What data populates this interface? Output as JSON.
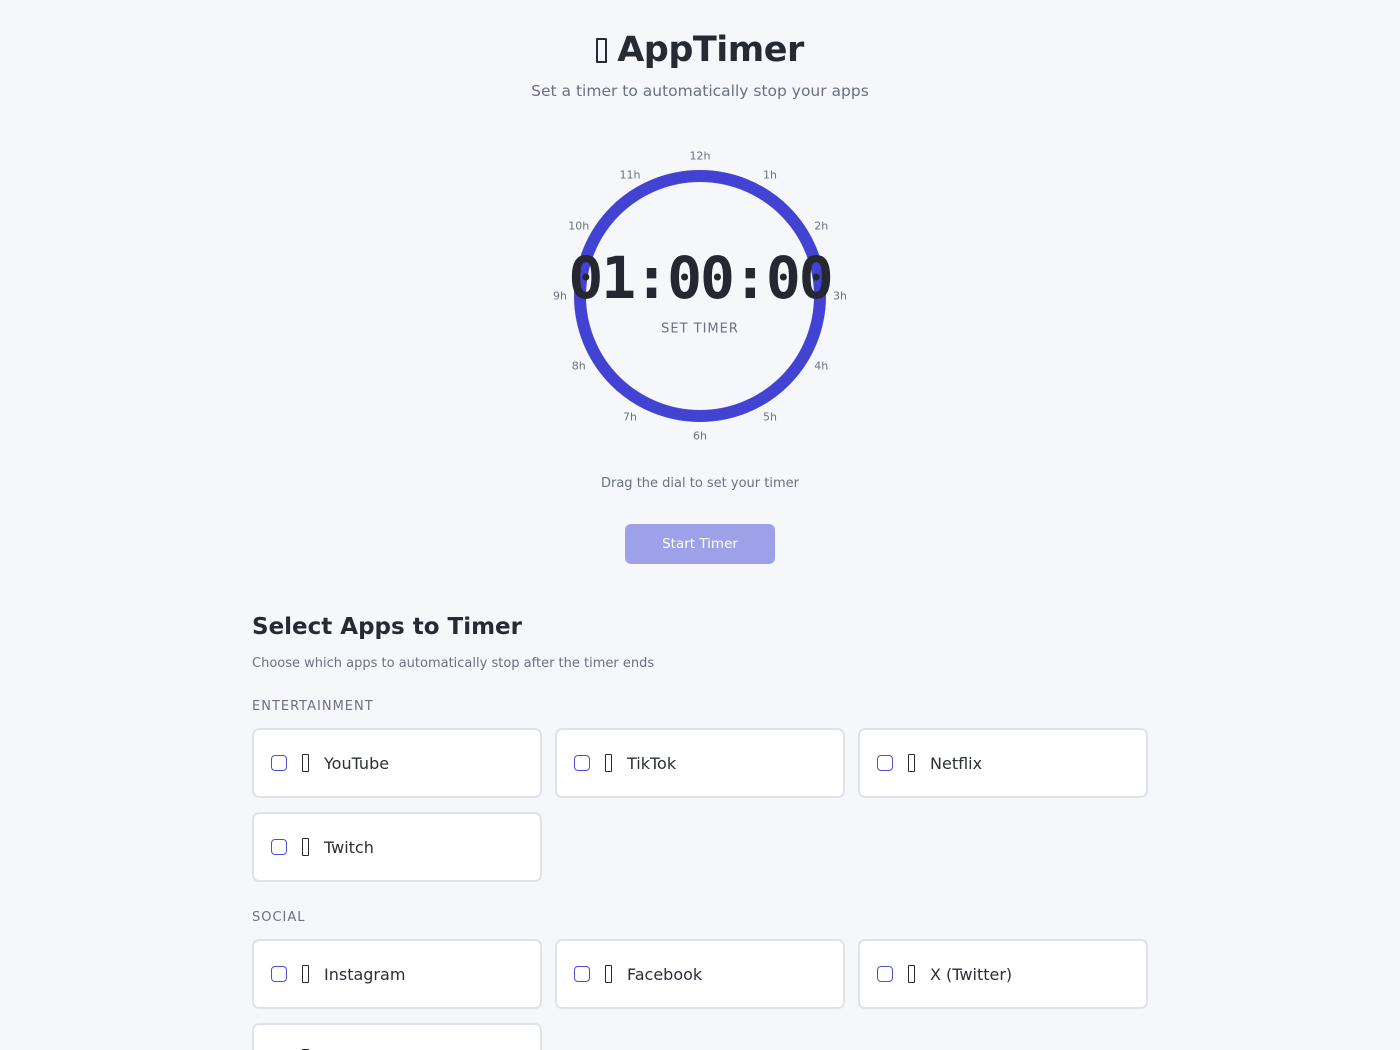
{
  "header": {
    "title": "AppTimer",
    "title_icon": "app-glyph-icon",
    "subtitle": "Set a timer to automatically stop your apps"
  },
  "dial": {
    "time": "01:00:00",
    "caption": "SET TIMER",
    "hour_labels": [
      "12h",
      "1h",
      "2h",
      "3h",
      "4h",
      "5h",
      "6h",
      "7h",
      "8h",
      "9h",
      "10h",
      "11h"
    ],
    "ring_color": "#4343d3",
    "progress": 1.0
  },
  "hint": "Drag the dial to set your timer",
  "start_button": {
    "label": "Start Timer",
    "color": "#9ea1e8"
  },
  "apps_section": {
    "title": "Select Apps to Timer",
    "description": "Choose which apps to automatically stop after the timer ends",
    "categories": [
      {
        "label": "ENTERTAINMENT",
        "apps": [
          {
            "name": "YouTube",
            "checked": false
          },
          {
            "name": "TikTok",
            "checked": false
          },
          {
            "name": "Netflix",
            "checked": false
          },
          {
            "name": "Twitch",
            "checked": false
          }
        ]
      },
      {
        "label": "SOCIAL",
        "apps": [
          {
            "name": "Instagram",
            "checked": false
          },
          {
            "name": "Facebook",
            "checked": false
          },
          {
            "name": "X (Twitter)",
            "checked": false
          },
          {
            "name": "",
            "checked": false
          }
        ]
      }
    ]
  },
  "colors": {
    "accent": "#4343d3",
    "background": "#f5f7fa",
    "card_border": "#dfe2e8"
  }
}
